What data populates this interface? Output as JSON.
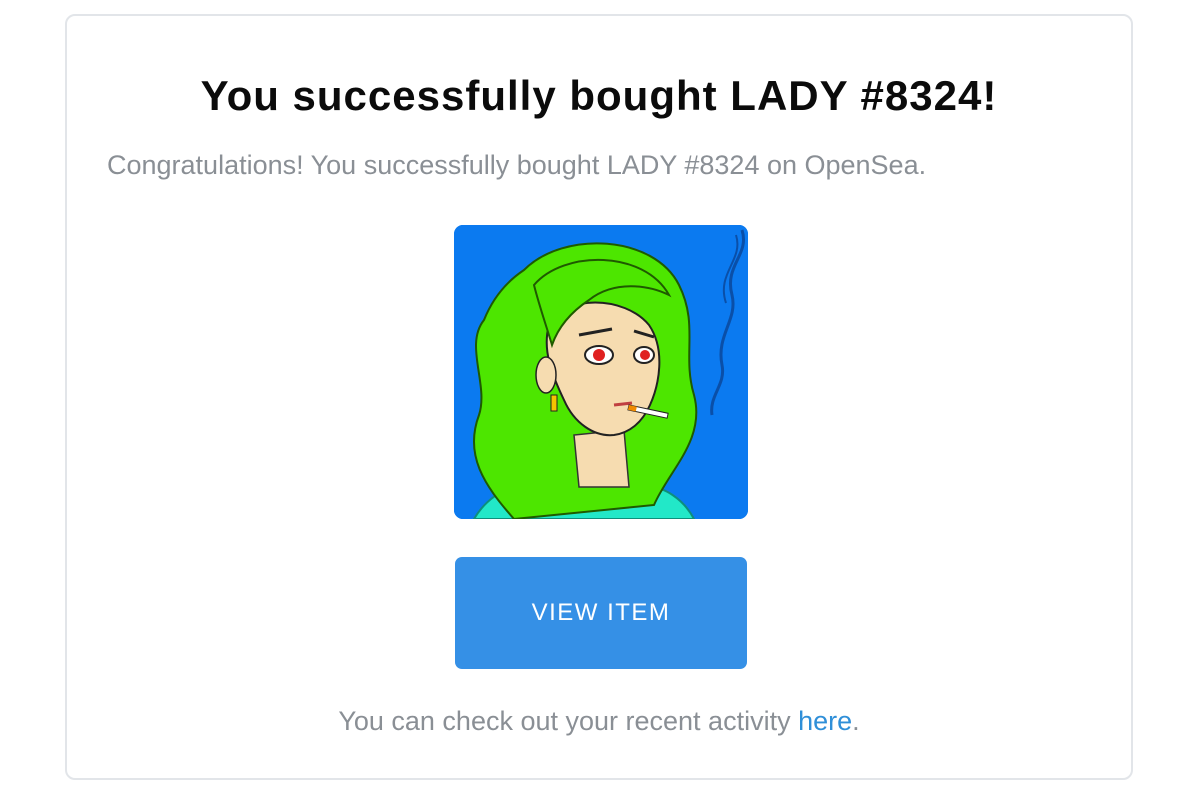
{
  "email": {
    "title": "You successfully bought LADY #8324!",
    "message": "Congratulations! You successfully bought LADY #8324 on OpenSea.",
    "image_alt": "LADY #8324",
    "button_label": "VIEW ITEM",
    "footer_prefix": "You can check out your recent activity ",
    "footer_link_label": "here",
    "footer_suffix": "."
  },
  "colors": {
    "button": "#3590e6",
    "link": "#2f8fd8",
    "image_background": "#0b7af0",
    "hair": "#4de600"
  }
}
